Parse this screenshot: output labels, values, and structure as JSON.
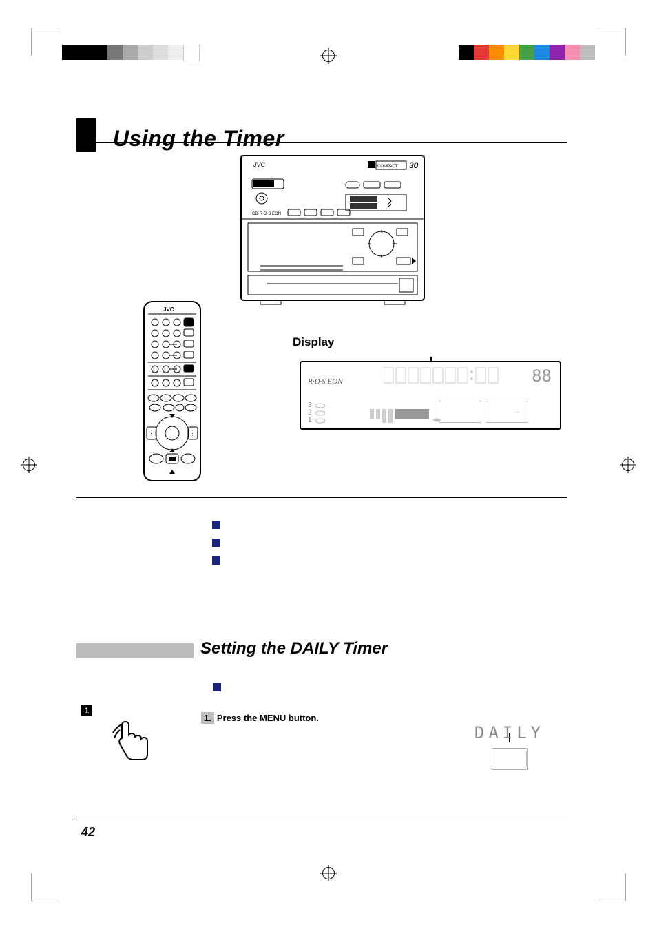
{
  "title": "Using the Timer",
  "display_label": "Display",
  "display": {
    "rds_text": "R·D·S EON",
    "segment_number": "88",
    "cd_rows": [
      "3",
      "2",
      "1"
    ]
  },
  "section2_title": "Setting the DAILY Timer",
  "step1": {
    "number_badge": "1",
    "list_number": "1.",
    "text": "Press the MENU button."
  },
  "daily_indicator_text": "DAILY",
  "page_number": "42",
  "colorbar_left": [
    "#000",
    "#000",
    "#000",
    "#777",
    "#aaa",
    "#ccc",
    "#ddd",
    "#eee",
    "#fff"
  ],
  "colorbar_right": [
    "#000",
    "#e53935",
    "#fb8c00",
    "#fdd835",
    "#43a047",
    "#1e88e5",
    "#8e24aa",
    "#f48fb1",
    "#bdbdbd"
  ]
}
